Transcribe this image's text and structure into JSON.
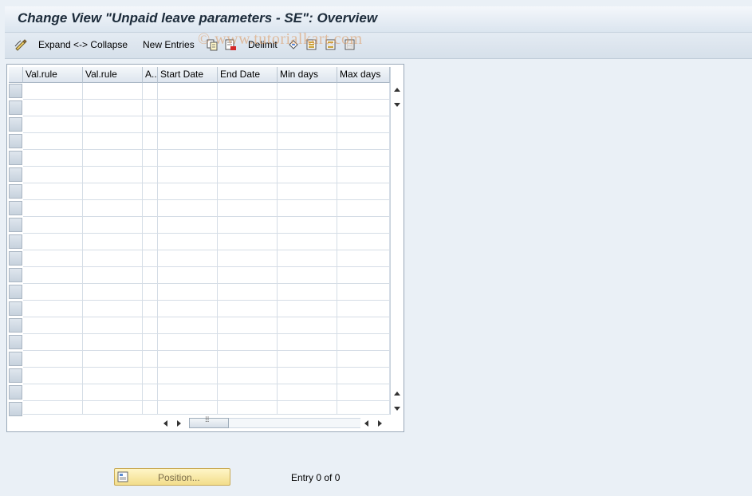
{
  "window": {
    "title": "Change View \"Unpaid leave parameters - SE\": Overview"
  },
  "toolbar": {
    "expand_collapse_label": "Expand <-> Collapse",
    "new_entries_label": "New Entries",
    "delimit_label": "Delimit",
    "watermark": "© www.tutorialkart.com"
  },
  "table": {
    "columns": [
      "Val.rule",
      "Val.rule",
      "A..",
      "Start Date",
      "End Date",
      "Min days",
      "Max days"
    ],
    "rows": []
  },
  "footer": {
    "position_label": "Position...",
    "entry_text": "Entry 0 of 0"
  }
}
